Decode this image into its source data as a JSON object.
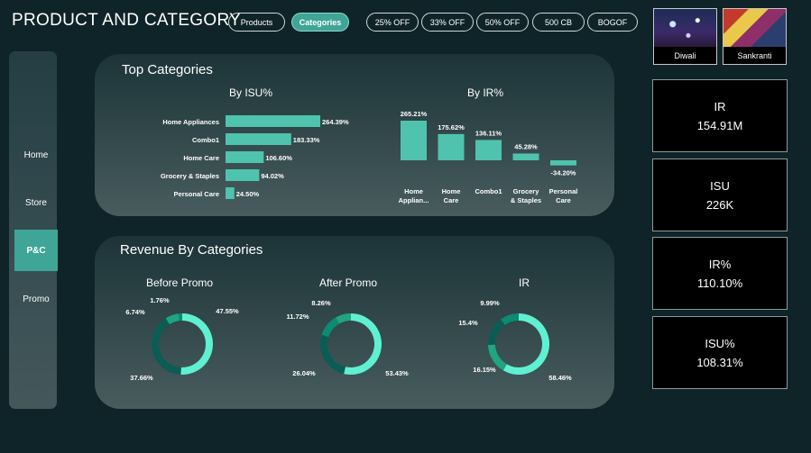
{
  "header": {
    "title": "PRODUCT AND CATEGORY"
  },
  "nav_pills": [
    {
      "label": "Products",
      "active": false
    },
    {
      "label": "Categories",
      "active": true
    }
  ],
  "offer_pills": [
    "25% OFF",
    "33% OFF",
    "50% OFF",
    "500 CB",
    "BOGOF"
  ],
  "festivals": [
    {
      "label": "Diwali"
    },
    {
      "label": "Sankranti"
    }
  ],
  "sidebar": {
    "items": [
      {
        "label": "Home",
        "active": false
      },
      {
        "label": "Store",
        "active": false
      },
      {
        "label": "P&C",
        "active": true
      },
      {
        "label": "Promo",
        "active": false
      }
    ]
  },
  "top_categories": {
    "panel_title": "Top Categories"
  },
  "revenue": {
    "panel_title": "Revenue By Categories"
  },
  "kpis": [
    {
      "label": "IR",
      "value": "154.91M"
    },
    {
      "label": "ISU",
      "value": "226K"
    },
    {
      "label": "IR%",
      "value": "110.10%"
    },
    {
      "label": "ISU%",
      "value": "108.31%"
    }
  ],
  "colors": {
    "bar": "#4fc3ae",
    "accent": "#3fa596",
    "donut_light": "#5ff0d2",
    "donut_dark": "#0b5c55",
    "donut_mid": "#1fa57f",
    "donut_small": "#0d8a72"
  },
  "chart_data": [
    {
      "type": "bar",
      "orientation": "horizontal",
      "title": "By ISU%",
      "categories": [
        "Home Appliances",
        "Combo1",
        "Home Care",
        "Grocery & Staples",
        "Personal Care"
      ],
      "values": [
        264.39,
        183.33,
        106.6,
        94.02,
        24.5
      ],
      "labels": [
        "264.39%",
        "183.33%",
        "106.60%",
        "94.02%",
        "24.50%"
      ]
    },
    {
      "type": "bar",
      "orientation": "vertical",
      "title": "By IR%",
      "categories": [
        "Home Applian...",
        "Home Care",
        "Combo1",
        "Grocery & Staples",
        "Personal Care"
      ],
      "values": [
        265.21,
        175.62,
        136.11,
        45.28,
        -34.2
      ],
      "labels": [
        "265.21%",
        "175.62%",
        "136.11%",
        "45.28%",
        "-34.20%"
      ]
    },
    {
      "type": "pie",
      "donut": true,
      "title": "Before Promo",
      "values": [
        47.55,
        37.66,
        6.74,
        1.76
      ],
      "labels": [
        "47.55%",
        "37.66%",
        "6.74%",
        "1.76%"
      ]
    },
    {
      "type": "pie",
      "donut": true,
      "title": "After Promo",
      "values": [
        53.43,
        26.04,
        11.72,
        8.26
      ],
      "labels": [
        "53.43%",
        "26.04%",
        "11.72%",
        "8.26%"
      ]
    },
    {
      "type": "pie",
      "donut": true,
      "title": "IR",
      "values": [
        58.46,
        16.15,
        15.4,
        9.99
      ],
      "labels": [
        "58.46%",
        "16.15%",
        "15.4%",
        "9.99%"
      ]
    }
  ]
}
